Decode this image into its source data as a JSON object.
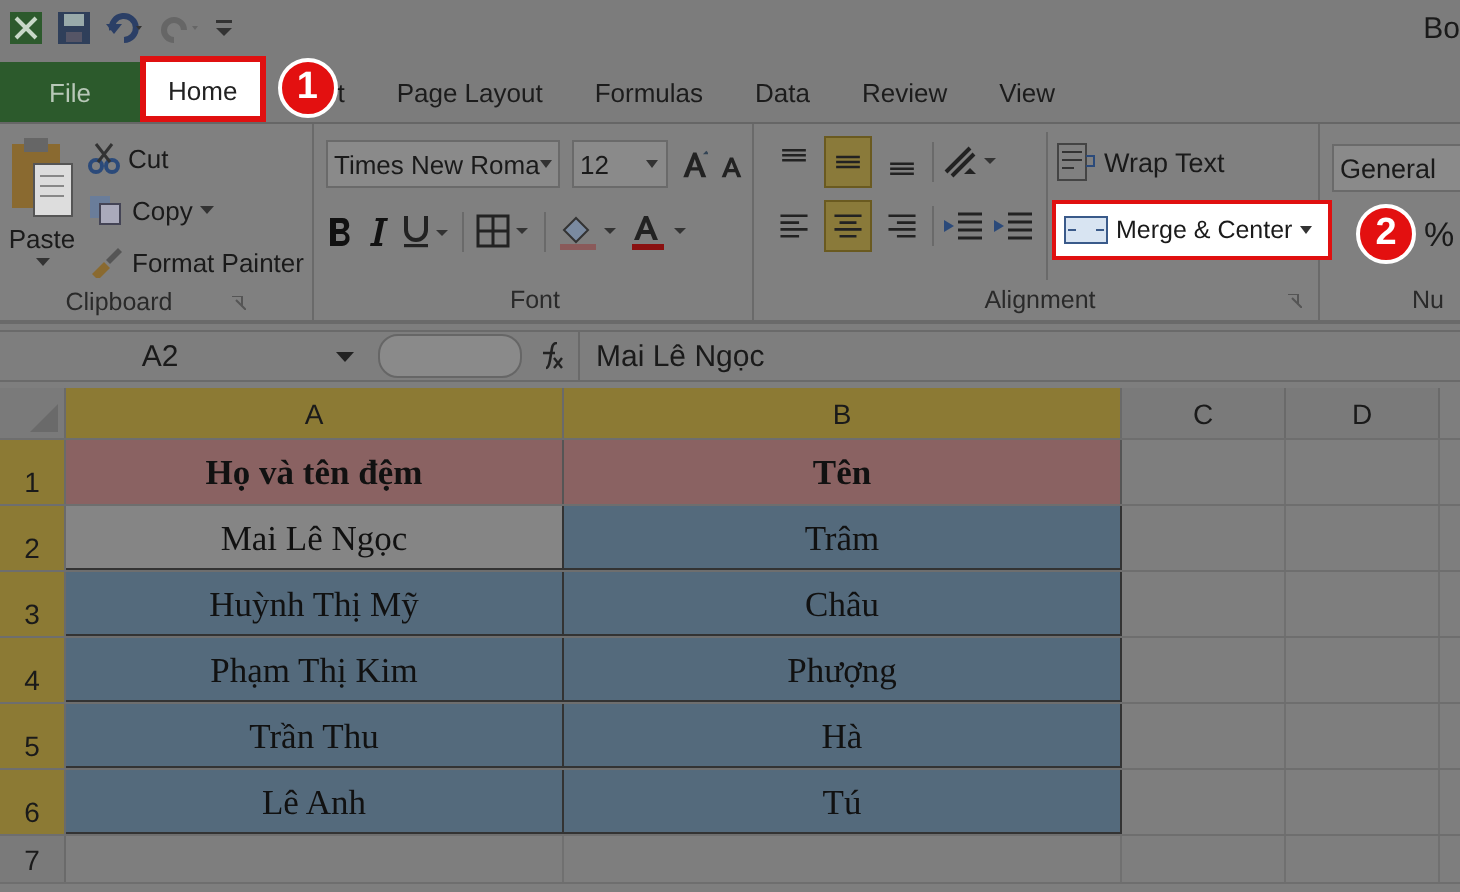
{
  "title": "Bo",
  "tabs": [
    {
      "label": "File",
      "kind": "file",
      "selected": false,
      "highlighted": false
    },
    {
      "label": "Home",
      "kind": "tab",
      "selected": true,
      "highlighted": true
    },
    {
      "label": "t",
      "kind": "tab",
      "selected": false,
      "highlighted": false
    },
    {
      "label": "Page Layout",
      "kind": "tab",
      "selected": false,
      "highlighted": false
    },
    {
      "label": "Formulas",
      "kind": "tab",
      "selected": false,
      "highlighted": false
    },
    {
      "label": "Data",
      "kind": "tab",
      "selected": false,
      "highlighted": false
    },
    {
      "label": "Review",
      "kind": "tab",
      "selected": false,
      "highlighted": false
    },
    {
      "label": "View",
      "kind": "tab",
      "selected": false,
      "highlighted": false
    }
  ],
  "callouts": [
    "1",
    "2"
  ],
  "clipboard": {
    "paste": "Paste",
    "cut": "Cut",
    "copy": "Copy",
    "format_painter": "Format Painter",
    "label": "Clipboard"
  },
  "font": {
    "name": "Times New Roma",
    "size": "12",
    "label": "Font"
  },
  "alignment": {
    "vertical": [
      {
        "kind": "top",
        "selected": false
      },
      {
        "kind": "middle",
        "selected": true
      },
      {
        "kind": "bottom",
        "selected": false
      }
    ],
    "horizontal": [
      {
        "kind": "left",
        "selected": false
      },
      {
        "kind": "center",
        "selected": true
      },
      {
        "kind": "right",
        "selected": false
      }
    ],
    "wrap_text": "Wrap Text",
    "merge": {
      "label": "Merge & Center",
      "highlighted": true
    },
    "label": "Alignment"
  },
  "number": {
    "format": "General",
    "percent": "%",
    "label": "Nu"
  },
  "formula_bar": {
    "name_box": "A2",
    "formula": "Mai Lê Ngọc"
  },
  "columns": [
    {
      "label": "A",
      "selected": true
    },
    {
      "label": "B",
      "selected": true
    },
    {
      "label": "C",
      "selected": false
    },
    {
      "label": "D",
      "selected": false
    }
  ],
  "rows": [
    {
      "number": "1",
      "kind": "heading",
      "selected": true,
      "cells": [
        {
          "text": "Họ và tên đệm",
          "active": false
        },
        {
          "text": "Tên",
          "active": false
        }
      ]
    },
    {
      "number": "2",
      "kind": "data",
      "selected": true,
      "cells": [
        {
          "text": "Mai Lê Ngọc",
          "active": true
        },
        {
          "text": "Trâm",
          "active": false
        }
      ]
    },
    {
      "number": "3",
      "kind": "data",
      "selected": true,
      "cells": [
        {
          "text": "Huỳnh Thị Mỹ",
          "active": false
        },
        {
          "text": "Châu",
          "active": false
        }
      ]
    },
    {
      "number": "4",
      "kind": "data",
      "selected": true,
      "cells": [
        {
          "text": "Phạm Thị Kim",
          "active": false
        },
        {
          "text": "Phượng",
          "active": false
        }
      ]
    },
    {
      "number": "5",
      "kind": "data",
      "selected": true,
      "cells": [
        {
          "text": "Trần Thu",
          "active": false
        },
        {
          "text": "Hà",
          "active": false
        }
      ]
    },
    {
      "number": "6",
      "kind": "data",
      "selected": true,
      "cells": [
        {
          "text": "Lê Anh",
          "active": false
        },
        {
          "text": "Tú",
          "active": false
        }
      ]
    },
    {
      "number": "7",
      "kind": "empty",
      "selected": false,
      "cells": []
    }
  ]
}
